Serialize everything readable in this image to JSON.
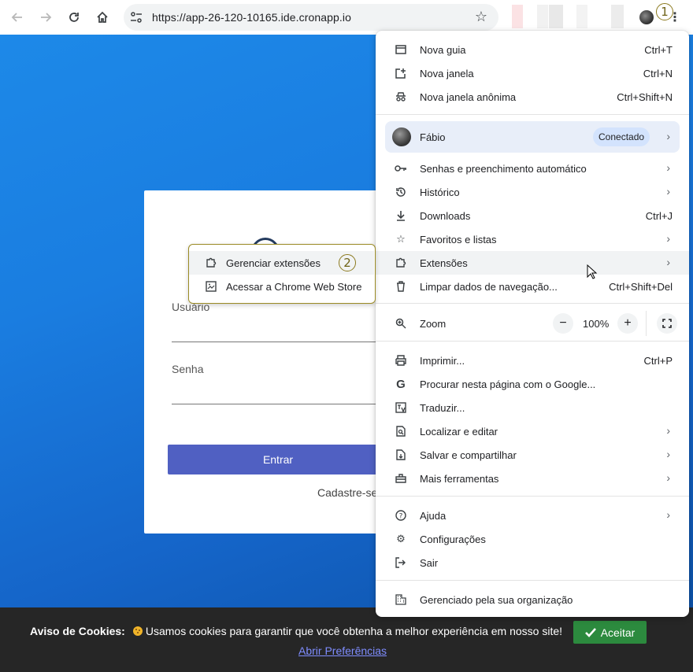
{
  "toolbar": {
    "url": "https://app-26-120-10165.ide.cronapp.io",
    "step_marker_1": "1"
  },
  "login": {
    "username_label": "Usuário",
    "password_label": "Senha",
    "submit_label": "Entrar",
    "signup_text": "Cadastre-se"
  },
  "cookie": {
    "title": "Aviso de Cookies:",
    "message": "Usamos cookies para garantir que você obtenha a melhor experiência em nosso site!",
    "accept_label": "Aceitar",
    "prefs_label": "Abrir Preferências"
  },
  "menu": {
    "new_tab": {
      "label": "Nova guia",
      "shortcut": "Ctrl+T"
    },
    "new_window": {
      "label": "Nova janela",
      "shortcut": "Ctrl+N"
    },
    "incognito": {
      "label": "Nova janela anônima",
      "shortcut": "Ctrl+Shift+N"
    },
    "profile": {
      "name": "Fábio",
      "status": "Conectado"
    },
    "passwords": {
      "label": "Senhas e preenchimento automático"
    },
    "history": {
      "label": "Histórico"
    },
    "downloads": {
      "label": "Downloads",
      "shortcut": "Ctrl+J"
    },
    "bookmarks": {
      "label": "Favoritos e listas"
    },
    "extensions": {
      "label": "Extensões"
    },
    "clear_data": {
      "label": "Limpar dados de navegação...",
      "shortcut": "Ctrl+Shift+Del"
    },
    "zoom": {
      "label": "Zoom",
      "value": "100%",
      "minus": "−",
      "plus": "+"
    },
    "print": {
      "label": "Imprimir...",
      "shortcut": "Ctrl+P"
    },
    "google_search": {
      "label": "Procurar nesta página com o Google..."
    },
    "translate": {
      "label": "Traduzir..."
    },
    "find_edit": {
      "label": "Localizar e editar"
    },
    "save_share": {
      "label": "Salvar e compartilhar"
    },
    "more_tools": {
      "label": "Mais ferramentas"
    },
    "help": {
      "label": "Ajuda"
    },
    "settings": {
      "label": "Configurações"
    },
    "exit": {
      "label": "Sair"
    },
    "managed": {
      "label": "Gerenciado pela sua organização"
    }
  },
  "submenu": {
    "manage_extensions": "Gerenciar extensões",
    "web_store": "Acessar a Chrome Web Store",
    "step_marker_2": "2"
  }
}
